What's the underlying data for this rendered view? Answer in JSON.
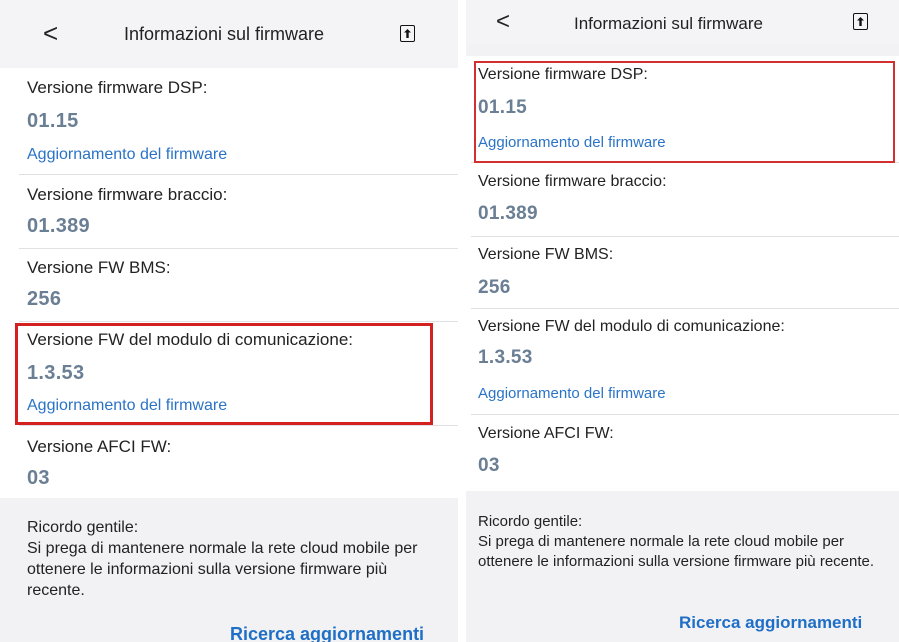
{
  "left": {
    "header": {
      "back": "<",
      "title": "Informazioni sul firmware",
      "share_icon": "share-upload-icon"
    },
    "items": [
      {
        "label": "Versione firmware DSP:",
        "value": "01.15",
        "link": "Aggiornamento del firmware"
      },
      {
        "label": "Versione firmware braccio:",
        "value": "01.389"
      },
      {
        "label": "Versione FW BMS:",
        "value": "256"
      },
      {
        "label": "Versione FW del modulo di comunicazione:",
        "value": "1.3.53",
        "link": "Aggiornamento del firmware"
      },
      {
        "label": "Versione AFCI FW:",
        "value": "03"
      }
    ],
    "note": {
      "title": "Ricordo gentile:",
      "text": "Si prega di mantenere normale la rete cloud mobile per ottenere le informazioni sulla versione firmware più recente."
    },
    "search_button": "Ricerca aggiornamenti",
    "highlight_color": "#d32020"
  },
  "right": {
    "header": {
      "back": "<",
      "title": "Informazioni sul firmware",
      "share_icon": "share-upload-icon"
    },
    "items": [
      {
        "label": "Versione firmware DSP:",
        "value": "01.15",
        "link": "Aggiornamento del firmware"
      },
      {
        "label": "Versione firmware braccio:",
        "value": "01.389"
      },
      {
        "label": "Versione FW BMS:",
        "value": "256"
      },
      {
        "label": "Versione FW del modulo di comunicazione:",
        "value": "1.3.53",
        "link": "Aggiornamento del firmware"
      },
      {
        "label": "Versione AFCI FW:",
        "value": "03"
      }
    ],
    "note": {
      "title": "Ricordo gentile:",
      "text": "Si prega di mantenere normale la rete cloud mobile per ottenere le informazioni sulla versione firmware più recente."
    },
    "search_button": "Ricerca aggiornamenti",
    "highlight_color": "#d23030"
  }
}
